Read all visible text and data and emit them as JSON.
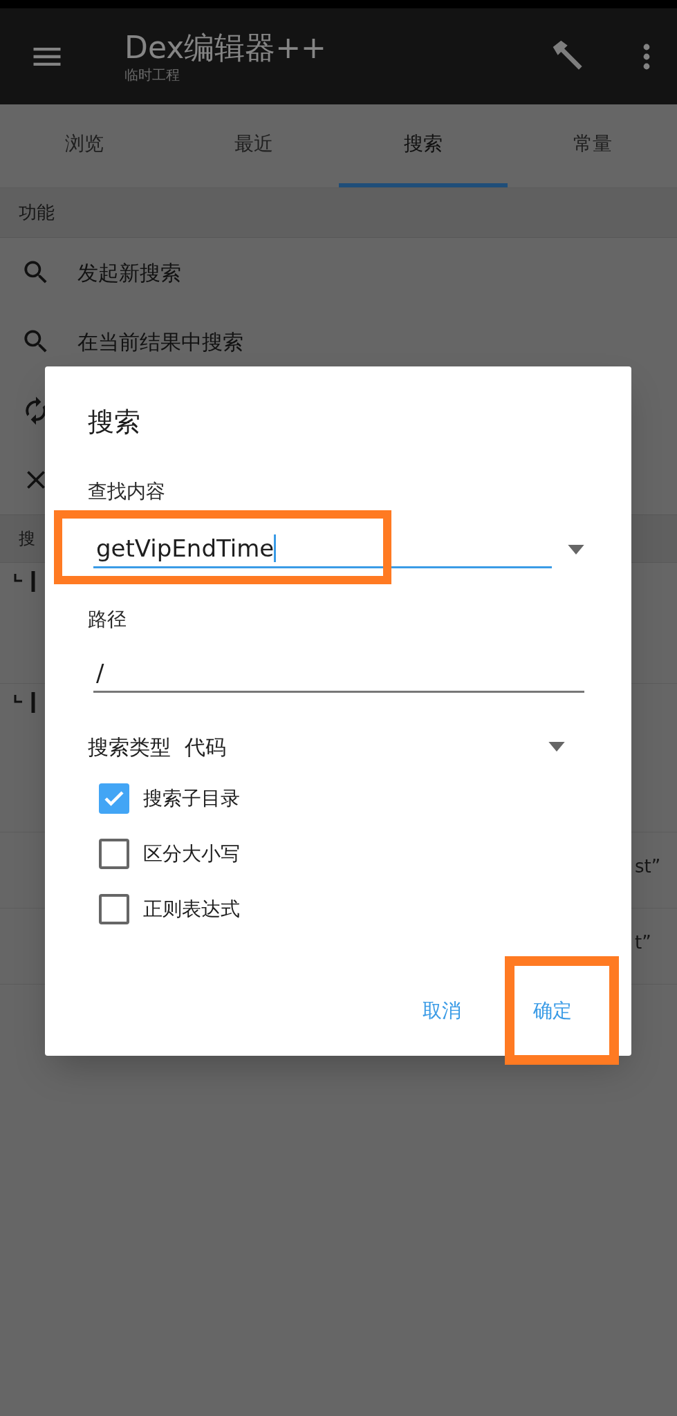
{
  "app_bar": {
    "title": "Dex编辑器++",
    "subtitle": "临时工程"
  },
  "tabs": [
    {
      "label": "浏览",
      "selected": false
    },
    {
      "label": "最近",
      "selected": false
    },
    {
      "label": "搜索",
      "selected": true
    },
    {
      "label": "常量",
      "selected": false
    }
  ],
  "functions": {
    "header": "功能",
    "items": [
      {
        "kind": "search",
        "label": "发起新搜索"
      },
      {
        "kind": "search",
        "label": "在当前结果中搜索"
      },
      {
        "kind": "refresh"
      },
      {
        "kind": "close"
      }
    ]
  },
  "results": {
    "header": "搜",
    "rows": [
      {
        "kind": "icon"
      },
      {
        "kind": "icon"
      },
      {
        "kind": "text",
        "text": "st”"
      },
      {
        "kind": "text",
        "text": "t”"
      }
    ]
  },
  "dialog": {
    "title": "搜索",
    "query": {
      "label": "查找内容",
      "value": "getVipEndTime",
      "focused": true
    },
    "path": {
      "label": "路径",
      "value": "/"
    },
    "search_type": {
      "label": "搜索类型",
      "value": "代码"
    },
    "options": [
      {
        "label": "搜索子目录",
        "checked": true
      },
      {
        "label": "区分大小写",
        "checked": false
      },
      {
        "label": "正则表达式",
        "checked": false
      }
    ],
    "buttons": [
      "取消",
      "确定"
    ]
  }
}
